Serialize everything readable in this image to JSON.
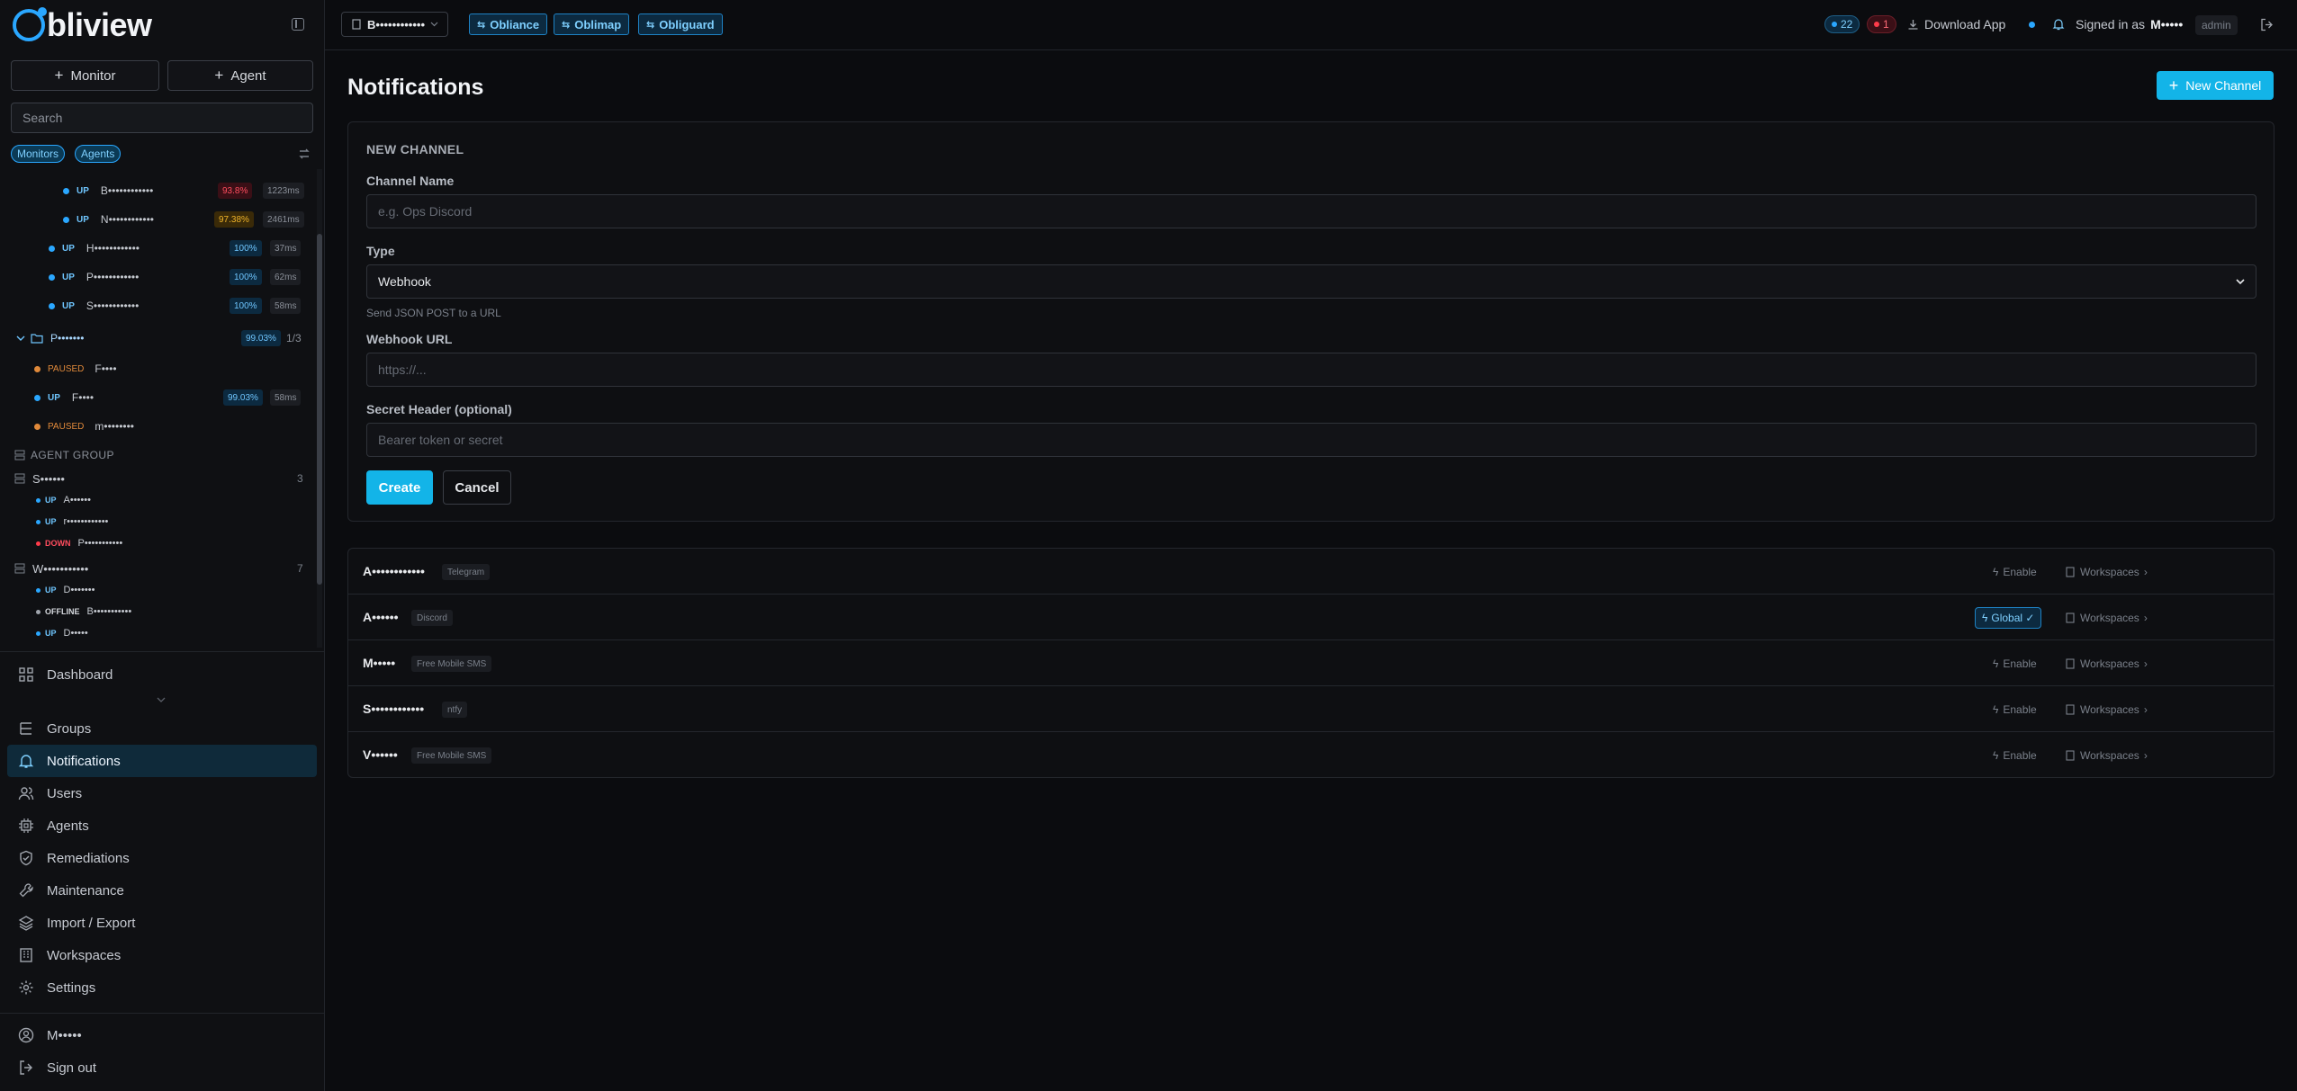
{
  "app": {
    "name": "bliview"
  },
  "sidebar": {
    "add_monitor": "Monitor",
    "add_agent": "Agent",
    "search_placeholder": "Search",
    "filters": [
      "Monitors",
      "Agents"
    ],
    "monitors": [
      {
        "status": "UP",
        "name": "B••••••••••••",
        "pct": "93.8%",
        "ms": "1223ms"
      },
      {
        "status": "UP",
        "name": "N••••••••••••",
        "pct": "97.38%",
        "ms": "2461ms"
      },
      {
        "status": "UP",
        "name": "H••••••••••••",
        "pct": "100%",
        "ms": "37ms"
      },
      {
        "status": "UP",
        "name": "P••••••••••••",
        "pct": "100%",
        "ms": "62ms"
      },
      {
        "status": "UP",
        "name": "S••••••••••••",
        "pct": "100%",
        "ms": "58ms"
      }
    ],
    "folder": {
      "name": "P•••••••",
      "pct": "99.03%",
      "count": "1/3"
    },
    "folder_monitors": [
      {
        "status": "PAUSED",
        "name": "F••••"
      },
      {
        "status": "UP",
        "name": "F••••",
        "pct": "99.03%",
        "ms": "58ms"
      },
      {
        "status": "PAUSED",
        "name": "m••••••••"
      }
    ],
    "agent_group_label": "AGENT GROUP",
    "agent_groups": [
      {
        "name": "S••••••",
        "count": "3",
        "agents": [
          {
            "status": "UP",
            "name": "A••••••"
          },
          {
            "status": "UP",
            "name": "r••••••••••••"
          },
          {
            "status": "DOWN",
            "name": "P•••••••••••"
          }
        ]
      },
      {
        "name": "W•••••••••••",
        "count": "7",
        "agents": [
          {
            "status": "UP",
            "name": "D•••••••"
          },
          {
            "status": "OFFLINE",
            "name": "B•••••••••••"
          },
          {
            "status": "UP",
            "name": "D•••••"
          }
        ]
      }
    ],
    "nav": [
      {
        "label": "Dashboard",
        "icon": "grid-icon"
      },
      {
        "label": "Groups",
        "icon": "groups-icon"
      },
      {
        "label": "Notifications",
        "icon": "bell-icon",
        "active": true
      },
      {
        "label": "Users",
        "icon": "users-icon"
      },
      {
        "label": "Agents",
        "icon": "cpu-icon"
      },
      {
        "label": "Remediations",
        "icon": "shield-icon"
      },
      {
        "label": "Maintenance",
        "icon": "wrench-icon"
      },
      {
        "label": "Import / Export",
        "icon": "layers-icon"
      },
      {
        "label": "Workspaces",
        "icon": "building-icon"
      },
      {
        "label": "Settings",
        "icon": "gear-icon"
      }
    ],
    "user": "M•••••",
    "signout": "Sign out"
  },
  "topbar": {
    "workspace": "B••••••••••••",
    "apps": [
      "Obliance",
      "Oblimap",
      "Obliguard"
    ],
    "up_count": "22",
    "down_count": "1",
    "download": "Download App",
    "signed_in_prefix": "Signed in as",
    "signed_in_user": "M•••••",
    "role": "admin"
  },
  "page": {
    "title": "Notifications",
    "new_channel": "New Channel"
  },
  "form": {
    "heading": "NEW CHANNEL",
    "name_label": "Channel Name",
    "name_placeholder": "e.g. Ops Discord",
    "type_label": "Type",
    "type_value": "Webhook",
    "type_hint": "Send JSON POST to a URL",
    "url_label": "Webhook URL",
    "url_placeholder": "https://...",
    "secret_label": "Secret Header (optional)",
    "secret_placeholder": "Bearer token or secret",
    "create": "Create",
    "cancel": "Cancel"
  },
  "channels": [
    {
      "name": "A••••••••••••",
      "type": "Telegram",
      "enable": "Enable",
      "workspaces": "Workspaces"
    },
    {
      "name": "A••••••",
      "type": "Discord",
      "global": "Global ✓",
      "workspaces": "Workspaces"
    },
    {
      "name": "M•••••",
      "type": "Free Mobile SMS",
      "enable": "Enable",
      "workspaces": "Workspaces"
    },
    {
      "name": "S••••••••••••",
      "type": "ntfy",
      "enable": "Enable",
      "workspaces": "Workspaces"
    },
    {
      "name": "V••••••",
      "type": "Free Mobile SMS",
      "enable": "Enable",
      "workspaces": "Workspaces"
    }
  ],
  "colors": {
    "accent": "#13b4e8",
    "up": "#2aa7ff",
    "down": "#ff3b4a",
    "paused": "#e0893a",
    "bg": "#0b0c0f"
  }
}
